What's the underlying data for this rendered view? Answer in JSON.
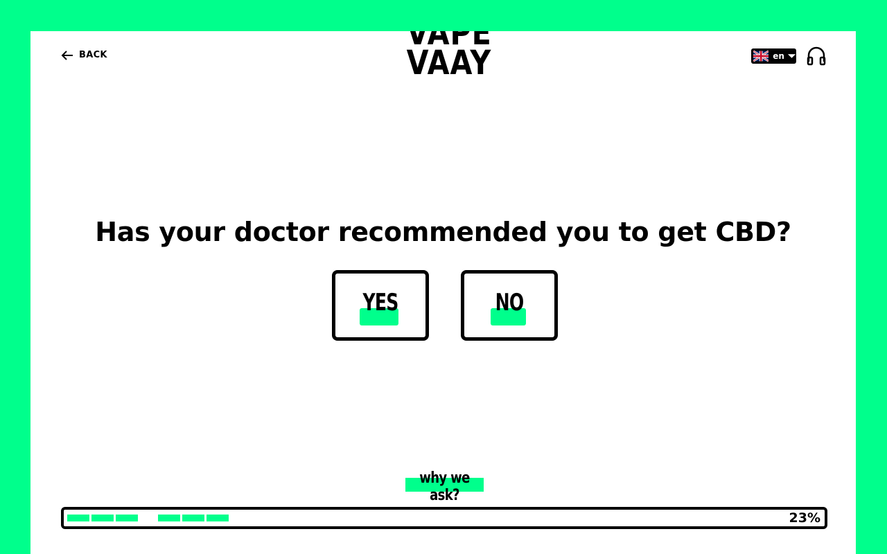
{
  "header": {
    "back_label": "BACK",
    "logo_line1": "VAPE",
    "logo_line2": "VAAY",
    "language_code": "en"
  },
  "question": {
    "text": "Has your doctor recommended you to get CBD?",
    "options": [
      {
        "label": "YES"
      },
      {
        "label": "NO"
      }
    ]
  },
  "why_label": "why we ask?",
  "progress": {
    "percent_label": "23%",
    "percent": 23,
    "completed_segments": 6
  },
  "colors": {
    "accent": "#00ff8c",
    "text": "#000000",
    "panel": "#ffffff"
  },
  "icons": [
    "arrow-left-icon",
    "uk-flag-icon",
    "chevron-down-icon",
    "headphones-icon"
  ]
}
